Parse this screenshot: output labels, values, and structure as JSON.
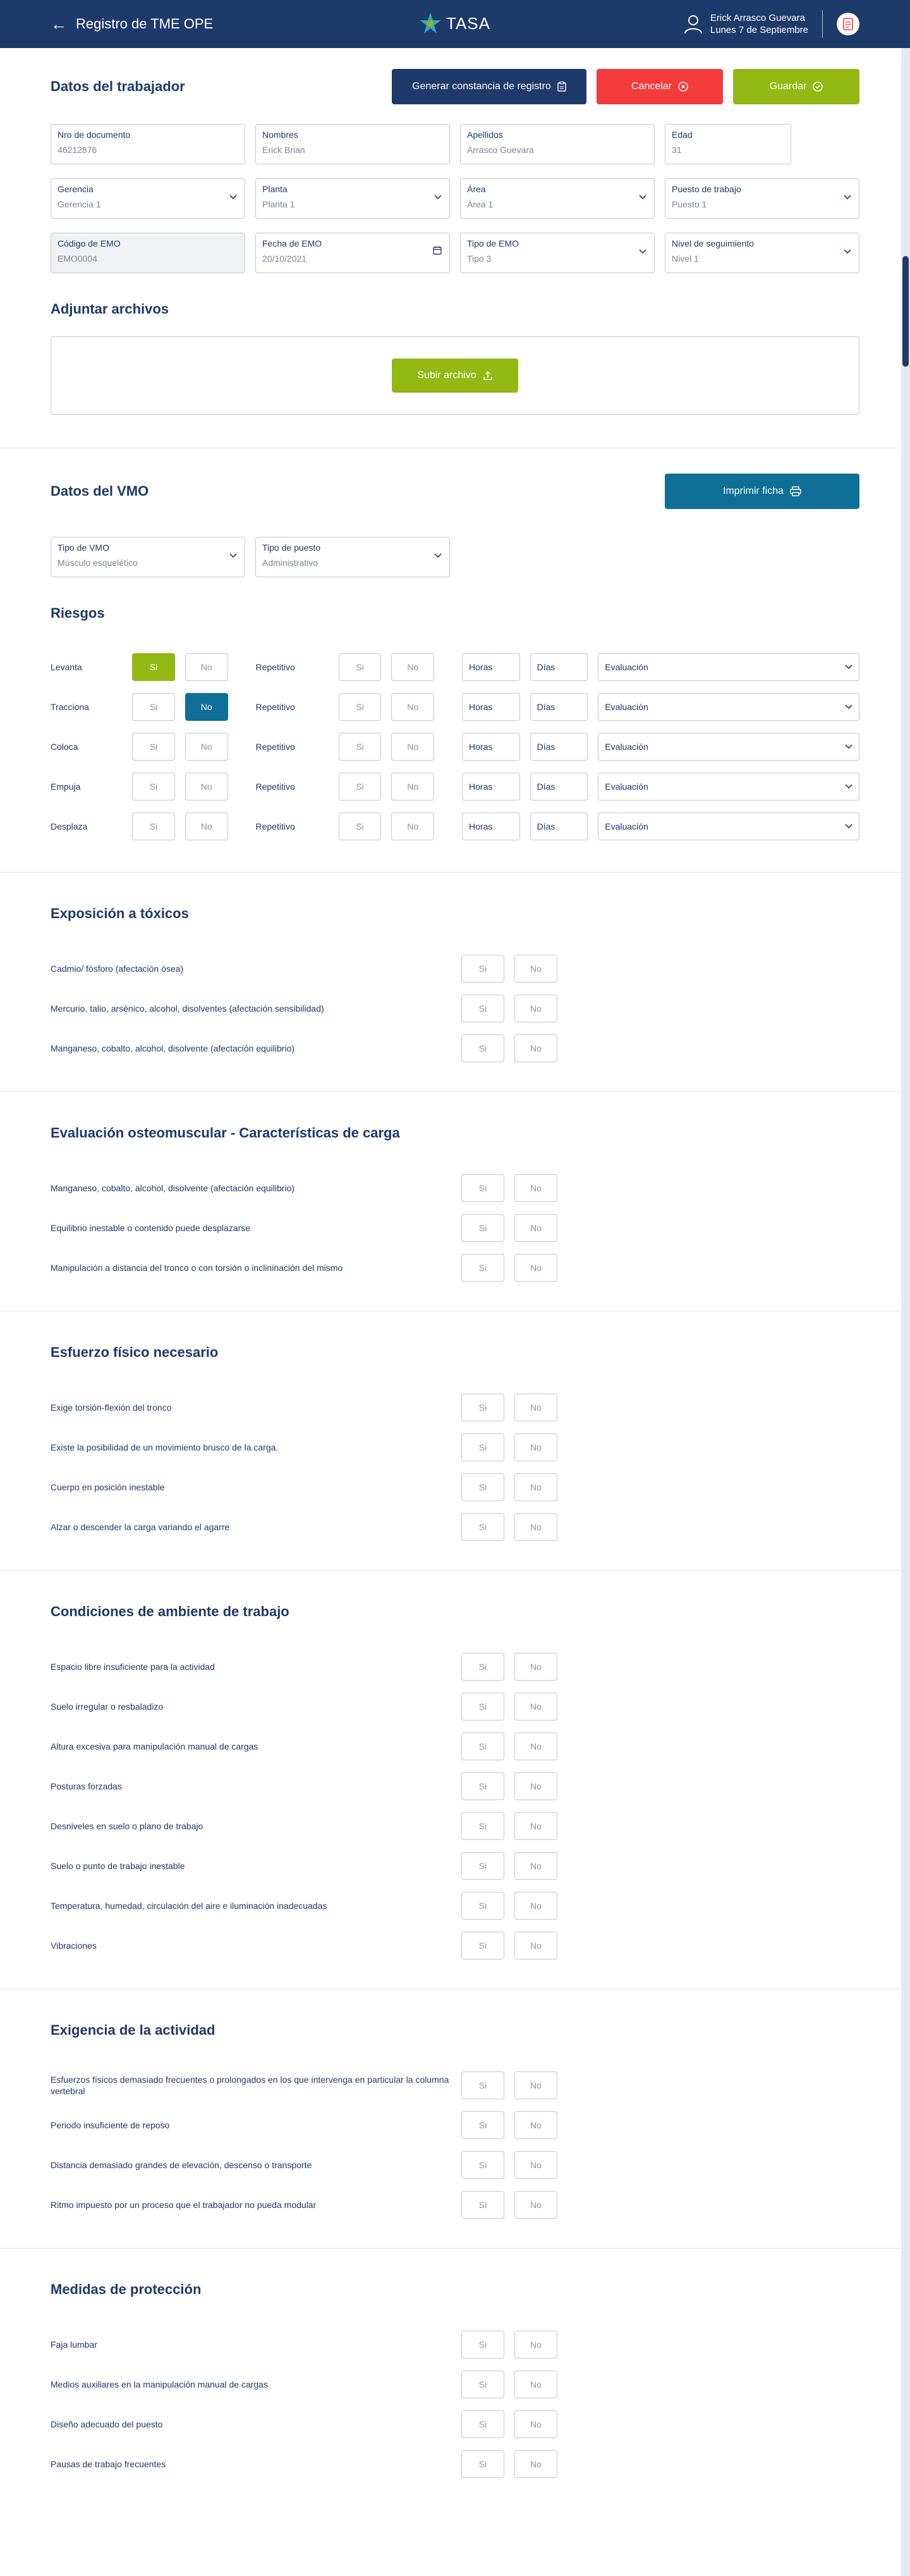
{
  "header": {
    "title": "Registro de TME OPE",
    "logo_text": "TASA",
    "user_name": "Erick Arrasco Guevara",
    "date": "Lunes 7 de Septiembre"
  },
  "trabajador": {
    "title": "Datos del trabajador",
    "btn_constancia": "Generar constancia de registro",
    "btn_cancelar": "Cancelar",
    "btn_guardar": "Guardar",
    "fields": {
      "documento": {
        "label": "Nro de documento",
        "value": "46212876"
      },
      "nombres": {
        "label": "Nombres",
        "value": "Erick Brian"
      },
      "apellidos": {
        "label": "Apellidos",
        "value": "Arrasco Guevara"
      },
      "edad": {
        "label": "Edad",
        "value": "31"
      },
      "gerencia": {
        "label": "Gerencia",
        "value": "Gerencia 1"
      },
      "planta": {
        "label": "Planta",
        "value": "Planta 1"
      },
      "area": {
        "label": "Área",
        "value": "Área 1"
      },
      "puesto": {
        "label": "Puesto de trabajo",
        "value": "Puesto 1"
      },
      "codigo_emo": {
        "label": "Código de EMO",
        "value": "EMO0004"
      },
      "fecha_emo": {
        "label": "Fecha de EMO",
        "value": "20/10/2021"
      },
      "tipo_emo": {
        "label": "Tipo de EMO",
        "value": "Tipo 3"
      },
      "nivel": {
        "label": "Nivel de seguimiento",
        "value": "Nivel 1"
      }
    }
  },
  "adjuntar": {
    "title": "Adjuntar archivos",
    "btn_subir": "Subir archivo"
  },
  "vmo": {
    "title": "Datos del VMO",
    "btn_imprimir": "Imprimir ficha",
    "tipo_vmo": {
      "label": "Tipo de VMO",
      "value": "Músculo esquelético"
    },
    "tipo_puesto": {
      "label": "Tipo de puesto",
      "value": "Administrativo"
    }
  },
  "riesgos": {
    "title": "Riesgos",
    "yes": "Si",
    "no": "No",
    "repetitivo": "Repetitivo",
    "horas": "Horas",
    "dias": "Días",
    "evaluacion": "Evaluación",
    "rows": [
      "Levanta",
      "Tracciona",
      "Coloca",
      "Empuja",
      "Desplaza"
    ]
  },
  "toxicos": {
    "title": "Exposición a tóxicos",
    "items": [
      "Cadmio/ fósforo (afectación ósea)",
      "Mercurio, talio, arsénico, alcohol, disolventes (afectación sensibilidad)",
      "Manganeso, cobalto, alcohol, disolvente (afectación equilibrio)"
    ]
  },
  "osteomuscular": {
    "title": "Evaluación osteomuscular - Características de carga",
    "items": [
      "Manganeso, cobalto, alcohol, disolvente (afectación equilibrio)",
      "Equilibrio inestable o contenido puede desplazarse",
      "Manipulación a distancia del tronco o con torsión o inclininación del mismo"
    ]
  },
  "esfuerzo": {
    "title": "Esfuerzo físico necesario",
    "items": [
      "Exige torsión-flexión del tronco",
      "Existe la posibilidad de un movimiento brusco de la carga.",
      "Cuerpo en posición inestable",
      "Alzar o descender la carga variando el agarre"
    ]
  },
  "ambiente": {
    "title": "Condiciones de ambiente de trabajo",
    "items": [
      "Espacio libre insuficiente para la actividad",
      "Suelo irregular o resbaladizo",
      "Altura excesiva para manipulación manual de cargas",
      "Posturas forzadas",
      "Desniveles en suelo o plano de trabajo",
      "Suelo o punto de trabajo inestable",
      "Temperatura, humedad, circulación del aire e iluminación inadecuadas",
      "Vibraciones"
    ]
  },
  "exigencia": {
    "title": "Exigencia de la actividad",
    "items": [
      "Esfuerzos físicos demasiado frecuentes o prolongados en los que intervenga en particular la columna vertebral",
      "Periodo insuficiente de reposo",
      "Distancia demasiado grandes de elevación, descenso o transporte",
      "Ritmo impuesto por un proceso que el trabajador no pueda modular"
    ]
  },
  "proteccion": {
    "title": "Medidas de protección",
    "items": [
      "Faja lumbar",
      "Medios auxiliares en la manipulación manual de cargas",
      "Diseño adecuado del puesto",
      "Pausas de trabajo frecuentes"
    ]
  },
  "colors": {
    "navy": "#1d3a6b",
    "green": "#93b814",
    "red": "#f33b3b",
    "teal": "#0f6f96"
  }
}
